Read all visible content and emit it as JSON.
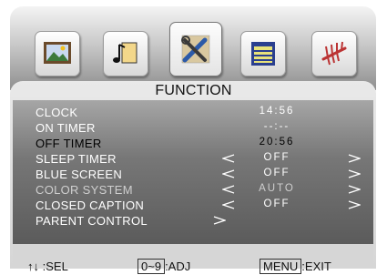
{
  "menu": {
    "title": "FUNCTION",
    "tabs": [
      {
        "name": "picture",
        "icon": "picture-icon",
        "active": false
      },
      {
        "name": "sound",
        "icon": "music-note-icon",
        "active": false
      },
      {
        "name": "function",
        "icon": "tools-icon",
        "active": true
      },
      {
        "name": "setup",
        "icon": "panel-icon",
        "active": false
      },
      {
        "name": "channel",
        "icon": "antenna-icon",
        "active": false
      }
    ],
    "items": [
      {
        "label": "CLOCK",
        "value": "14:56"
      },
      {
        "label": "ON TIMER",
        "value": "--:--"
      },
      {
        "label": "OFF TIMER",
        "value": "20:56"
      },
      {
        "label": "SLEEP TIMER",
        "value": "OFF"
      },
      {
        "label": "BLUE SCREEN",
        "value": "OFF"
      },
      {
        "label": "COLOR SYSTEM",
        "value": "AUTO"
      },
      {
        "label": "CLOSED CAPTION",
        "value": "OFF"
      },
      {
        "label": "PARENT CONTROL",
        "value": ""
      }
    ]
  },
  "footer": {
    "sel_arrows": "↑↓",
    "sel_text": " :SEL",
    "adj_key": "0~9",
    "adj_text": ":ADJ",
    "exit_key": "MENU",
    "exit_text": ":EXIT"
  },
  "colors": {
    "panel_gray": "#d6d6d6",
    "content_gray": "#777777",
    "text_white": "#ffffff",
    "selected_text": "#000000",
    "disabled_text": "#cfcfcf"
  }
}
